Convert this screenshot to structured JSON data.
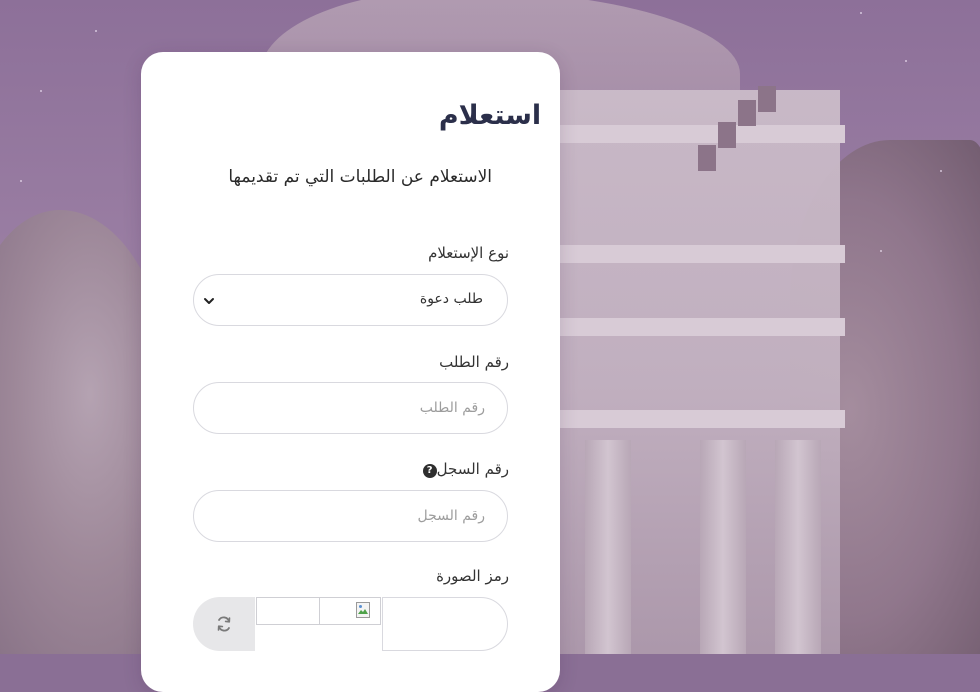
{
  "form": {
    "title": "استعلام",
    "subtitle": "الاستعلام عن الطلبات التي تم تقديمها",
    "inquiry_type": {
      "label": "نوع الإستعلام",
      "selected": "طلب دعوة",
      "icon": "chevron-down-icon"
    },
    "request_number": {
      "label": "رقم الطلب",
      "placeholder": "رقم الطلب",
      "value": ""
    },
    "record_number": {
      "label": "رقم السجل",
      "placeholder": "رقم السجل",
      "value": "",
      "help_icon": "question-circle-icon"
    },
    "captcha": {
      "label": "رمز الصورة",
      "refresh_icon": "refresh-icon",
      "image_icon": "broken-image-icon"
    }
  },
  "colors": {
    "background": "#8d7099",
    "card": "#ffffff",
    "title": "#2b2f4a",
    "field_border": "#d9d9df",
    "refresh_bg": "#e7e7e9"
  }
}
